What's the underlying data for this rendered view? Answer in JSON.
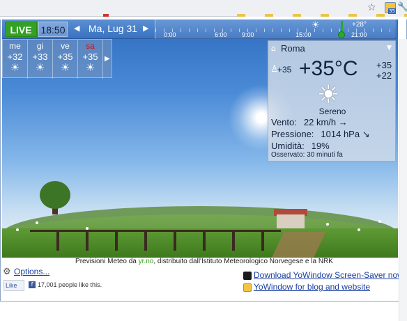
{
  "browser": {
    "star_icon": "star-icon",
    "extension_badge": "35",
    "wrench_icon": "wrench-icon"
  },
  "topbar": {
    "live_label": "LIVE",
    "time": "18:50",
    "date": "Ma, Lug 31",
    "prev_icon": "chevron-left-icon",
    "next_icon": "chevron-right-icon",
    "timeline": {
      "hours": [
        "0:00",
        "6:00",
        "9:00",
        "15:00",
        "21:00"
      ],
      "current_temp": "+28°",
      "sun_icon": "sun-icon"
    }
  },
  "forecast": {
    "days": [
      {
        "name": "me",
        "temp": "+32",
        "weekend": false
      },
      {
        "name": "gi",
        "temp": "+33",
        "weekend": false
      },
      {
        "name": "ve",
        "temp": "+35",
        "weekend": false
      },
      {
        "name": "sa",
        "temp": "+35",
        "weekend": true
      }
    ],
    "icon": "sun-icon",
    "more_icon": "chevron-right-icon"
  },
  "current": {
    "city": "Roma",
    "feels_like": "+35",
    "temperature": "+35°C",
    "high": "+35",
    "low": "+22",
    "condition": "Sereno",
    "wind_label": "Vento:",
    "wind_value": "22 km/h →",
    "pressure_label": "Pressione:",
    "pressure_value": "1014 hPa ↘",
    "humidity_label": "Umidità:",
    "humidity_value": "19%",
    "observed_label": "Osservato:",
    "observed_value": "30 minuti fa"
  },
  "footer": {
    "credit_prefix": "Previsioni Meteo da",
    "credit_link": "yr.no",
    "credit_suffix": ", distribuito dall'Istituto Meteorologico Norvegese e la NRK",
    "options": "Options...",
    "like_label": "Like",
    "likes_text": "17,001 people like this.",
    "download_link": "Download YoWindow Screen-Saver now!",
    "blog_link": "YoWindow for blog and website"
  },
  "colors": {
    "live_green": "#33a123",
    "topbar_blue": "#3a72c0",
    "weekend_red": "#c81a1a",
    "link_blue": "#1a3fa0"
  }
}
